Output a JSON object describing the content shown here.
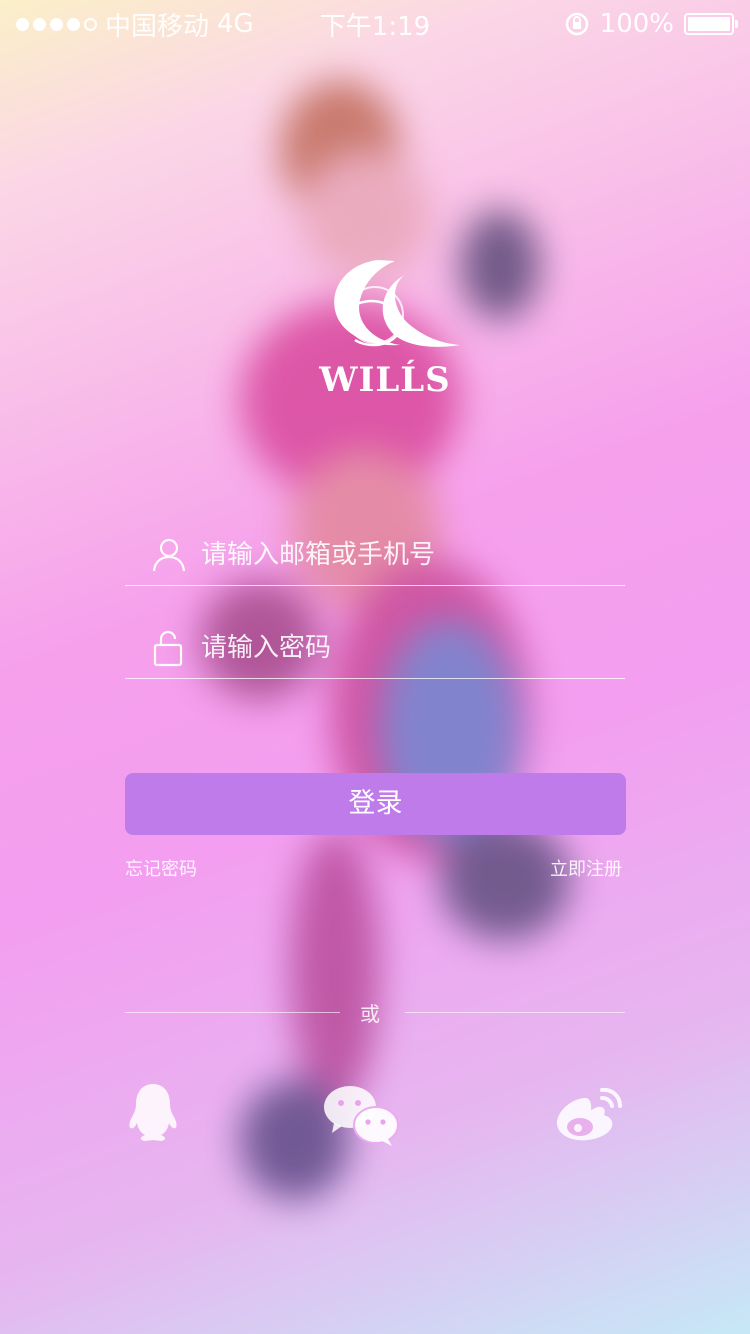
{
  "status_bar": {
    "carrier": "中国移动",
    "network": "4G",
    "time": "下午1:19",
    "battery": "100%",
    "battery_level": 1.0,
    "signal_bars": 5
  },
  "logo": {
    "text": "WILĹS"
  },
  "account_field": {
    "placeholder": "请输入邮箱或手机号",
    "value": "",
    "icon": "user-icon"
  },
  "password_field": {
    "placeholder": "请输入密码",
    "value": "",
    "icon": "lock-icon"
  },
  "login_button": {
    "label": "登录"
  },
  "links": {
    "forgot_password": "忘记密码",
    "register": "立即注册"
  },
  "divider": {
    "label": "或"
  },
  "social_logins": [
    {
      "icon": "qq-icon"
    },
    {
      "icon": "wechat-icon"
    },
    {
      "icon": "weibo-icon"
    }
  ],
  "colors": {
    "button": "#c07bea",
    "text": "#ffffff"
  }
}
